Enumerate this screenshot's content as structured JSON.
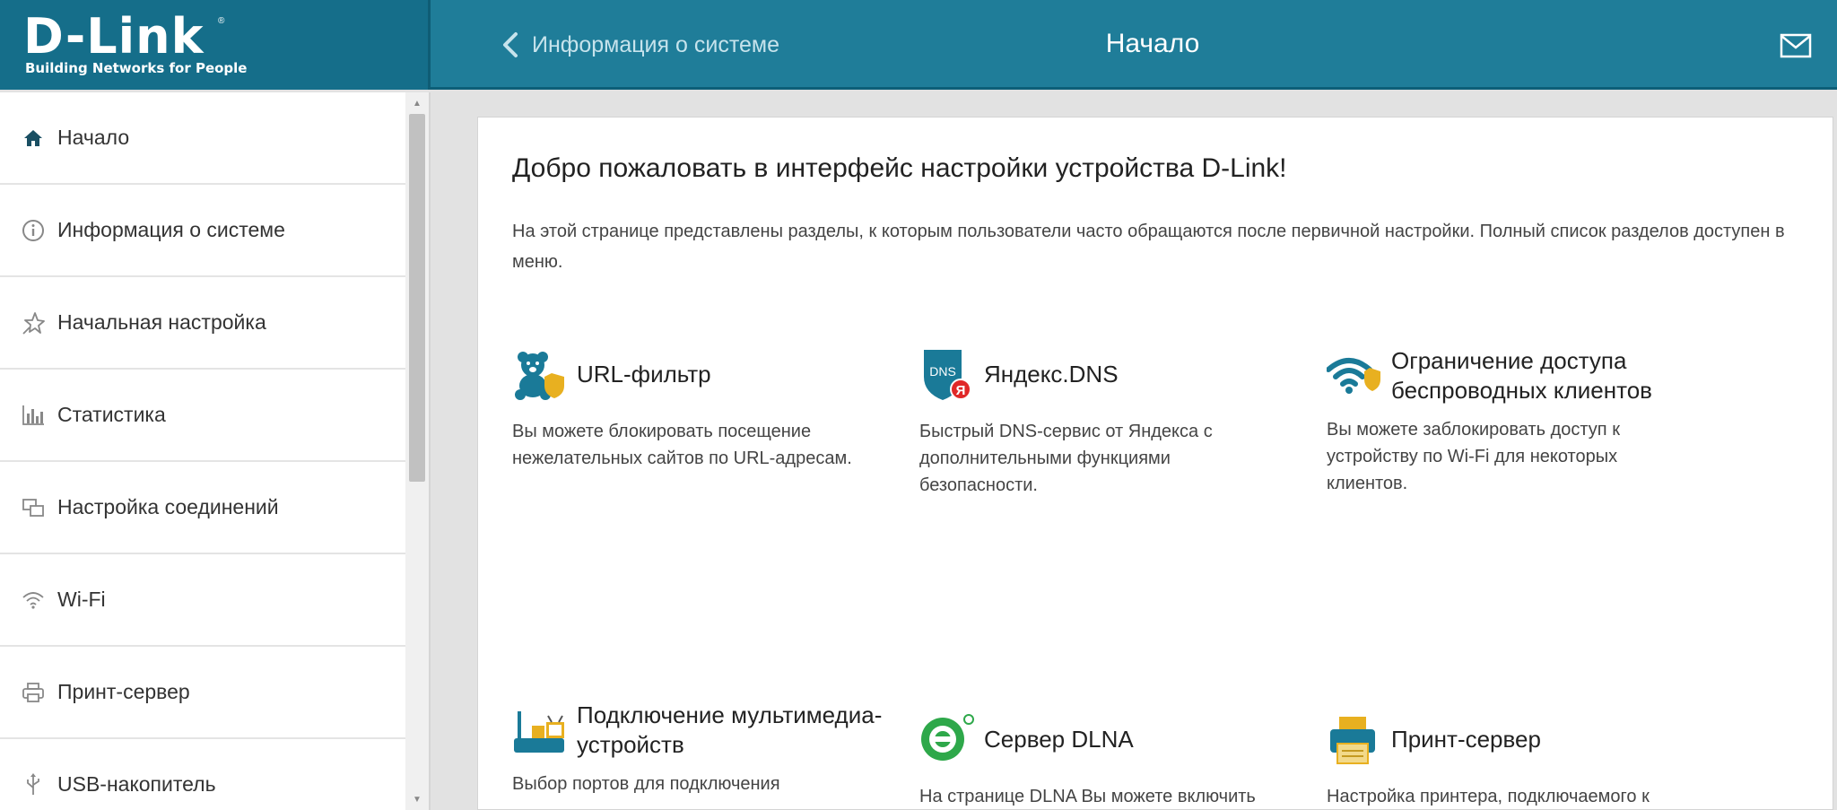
{
  "header": {
    "logo": "D-Link",
    "logo_sub": "Building Networks for People",
    "back_label": "Информация о системе",
    "title": "Начало"
  },
  "sidebar": {
    "items": [
      {
        "label": "Начало",
        "icon": "home-icon"
      },
      {
        "label": "Информация о системе",
        "icon": "info-icon"
      },
      {
        "label": "Начальная настройка",
        "icon": "star-icon"
      },
      {
        "label": "Статистика",
        "icon": "chart-icon"
      },
      {
        "label": "Настройка соединений",
        "icon": "connections-icon"
      },
      {
        "label": "Wi-Fi",
        "icon": "wifi-icon"
      },
      {
        "label": "Принт-сервер",
        "icon": "printer-icon"
      },
      {
        "label": "USB-накопитель",
        "icon": "usb-icon"
      }
    ]
  },
  "main": {
    "welcome": "Добро пожаловать в интерфейс настройки устройства D-Link!",
    "intro": "На этой странице представлены разделы, к которым пользователи часто обращаются после первичной настройки. Полный список разделов доступен в меню.",
    "tiles": [
      {
        "title": "URL-фильтр",
        "desc": "Вы можете блокировать посещение нежелательных сайтов по URL-адресам.",
        "icon": "teddy-bear-shield-icon"
      },
      {
        "title": "Яндекс.DNS",
        "badge": "DNS",
        "desc": "Быстрый DNS-сервис от Яндекса с дополнительными функциями безопасности.",
        "icon": "yandex-dns-shield-icon"
      },
      {
        "title": "Ограничение доступа беспроводных клиентов",
        "desc": "Вы можете заблокировать доступ к устройству по Wi-Fi для некоторых клиентов.",
        "icon": "wifi-shield-icon"
      },
      {
        "title": "Подключение мультимедиа-устройств",
        "desc": "Выбор портов для подключения",
        "icon": "router-tv-icon"
      },
      {
        "title": "Сервер DLNA",
        "desc": "На странице DLNA Вы можете включить",
        "icon": "dlna-icon"
      },
      {
        "title": "Принт-сервер",
        "desc": "Настройка принтера, подключаемого к",
        "icon": "printer-large-icon"
      }
    ]
  },
  "colors": {
    "header": "#1f7d99",
    "logo_bg": "#156e8a",
    "accent_teal": "#1a7a98",
    "shield_gold": "#e8b020"
  }
}
